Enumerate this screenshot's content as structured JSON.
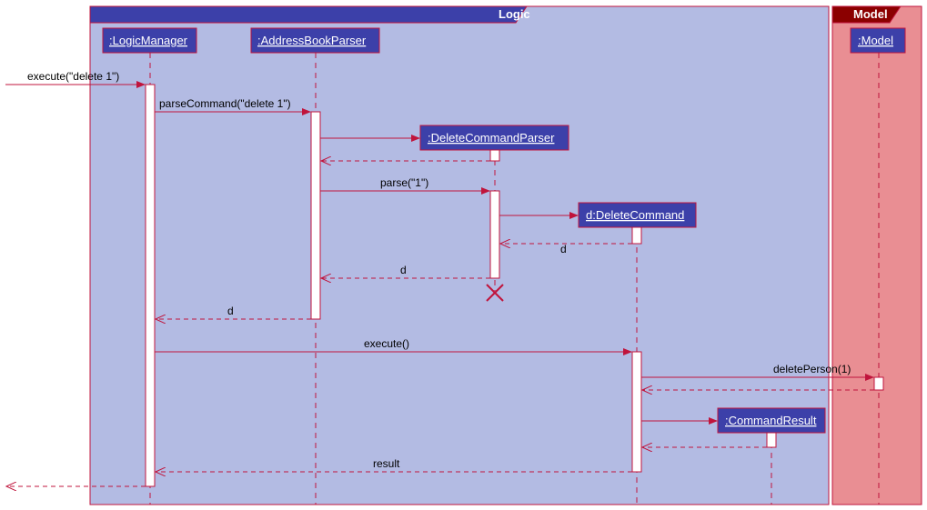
{
  "frames": {
    "logic": "Logic",
    "model": "Model"
  },
  "participants": {
    "logicManager": ":LogicManager",
    "addressBookParser": ":AddressBookParser",
    "deleteCommandParser": ":DeleteCommandParser",
    "deleteCommand": "d:DeleteCommand",
    "commandResult": ":CommandResult",
    "model": ":Model"
  },
  "messages": {
    "execute_in": "execute(\"delete 1\")",
    "parseCommand": "parseCommand(\"delete 1\")",
    "parse1": "parse(\"1\")",
    "return_d1": "d",
    "return_d2": "d",
    "return_d3": "d",
    "execute": "execute()",
    "deletePerson": "deletePerson(1)",
    "result": "result"
  }
}
